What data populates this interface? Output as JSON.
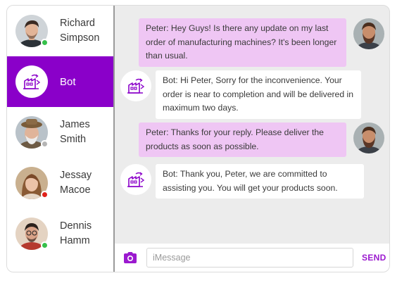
{
  "colors": {
    "accent": "#8a00c9",
    "user_bubble": "#efc6f4",
    "bot_bubble": "#ffffff",
    "online": "#35c04a",
    "offline": "#b5b5b5",
    "busy": "#e0211a"
  },
  "contacts": [
    {
      "name": "Richard\nSimpson",
      "status": "online",
      "avatar": "man-avatar"
    },
    {
      "name": "Bot",
      "status": "active",
      "avatar": "factory-bot-icon"
    },
    {
      "name": "James\nSmith",
      "status": "offline",
      "avatar": "old-man-avatar"
    },
    {
      "name": "Jessay\nMacoe",
      "status": "busy",
      "avatar": "woman-avatar"
    },
    {
      "name": "Dennis\nHamm",
      "status": "online",
      "avatar": "man-glasses-avatar"
    }
  ],
  "messages": [
    {
      "from": "user",
      "text": "Peter: Hey Guys! Is there any update on my last order of manufacturing machines? It's been longer than usual."
    },
    {
      "from": "bot",
      "text": "Bot: Hi Peter, Sorry for the inconvenience. Your order is near to completion and will be delivered in maximum two days."
    },
    {
      "from": "user",
      "text": "Peter: Thanks for your reply. Please deliver the products as soon as possible."
    },
    {
      "from": "bot",
      "text": "Bot: Thank you, Peter, we are committed to assisting you. You will get your products soon."
    }
  ],
  "composer": {
    "placeholder": "iMessage",
    "value": "",
    "send_label": "SEND",
    "camera_icon": "camera-icon"
  }
}
